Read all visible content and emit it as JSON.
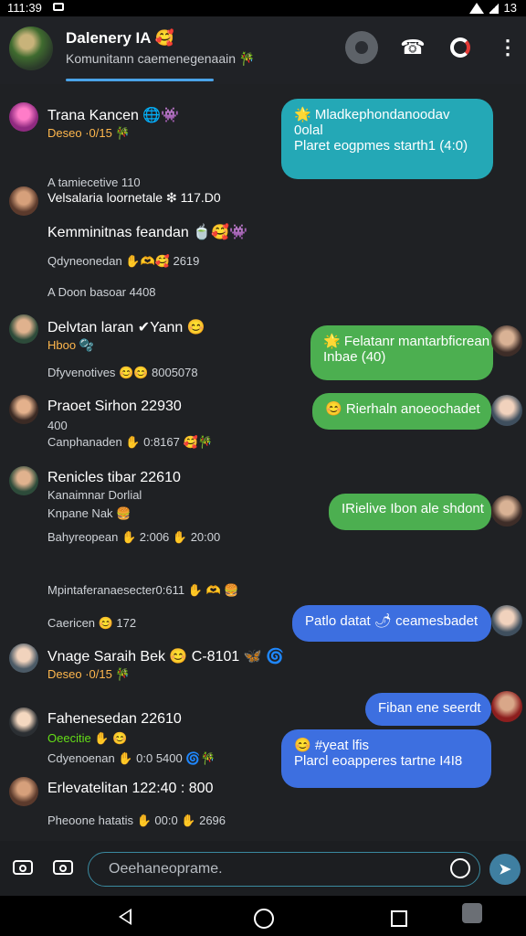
{
  "status_bar": {
    "time": "111:39",
    "right": "13"
  },
  "header": {
    "title": "Dalenery IA 🥰",
    "subtitle": "Komunitann caemenegenaain 🎋"
  },
  "messages_left": [
    {
      "name": "Trana Kancen 🌐👾",
      "meta1": "Deseo ·0/15 🎋",
      "meta2": "A tamiecetive 110"
    },
    {
      "name": "Velsalaria loornetale ❇ 117.D0",
      "meta1": "Kemminitnas feandan 🍵🥰👾",
      "meta2": "Qdyneonedan ✋🫶🥰 2619",
      "meta3": "A Doon basoar 4408"
    },
    {
      "name": "Delvtan laran ✔Yann 😊",
      "meta1": "Hboo 🫧",
      "meta2": "Dfyvenotives 😊😊 8005078"
    },
    {
      "name": "Praoet Sirhon 22930",
      "meta1": "400",
      "meta2": "Canphanaden ✋ 0:8167 🥰🎋"
    },
    {
      "name": "Renicles tibar 22610",
      "meta1": "Kanaimnar Dorlial",
      "meta2": "Knpane Nak 🍔",
      "meta3": "Bahyreopean ✋ 2:006 ✋ 20:00"
    },
    {
      "name": "",
      "meta1": "Mpintaferanaesecter0:611 ✋ 🫶 🍔",
      "meta2": "Caericen 😊 172"
    },
    {
      "name": "Vnage Saraih Bek 😊 C-8101 🦋 🌀",
      "meta1": "Deseo ·0/15 🎋"
    },
    {
      "name": "Fahenesedan 22610",
      "meta1": "Oeecitie ✋ 😊",
      "meta2": "Cdyenoenan ✋ 0:0 5400 🌀🎋"
    },
    {
      "name": "Erlevatelitan 122:40 : 800",
      "meta1": "Pheoone hatatis ✋ 00:0 ✋ 2696"
    }
  ],
  "messages_right": [
    {
      "line1": "🌟 Mladkephondanoodav",
      "line2": "0olal",
      "line3": "Plaret eogpmes starth1 (4:0)"
    },
    {
      "line1": "🌟 Felatanr mantarbficrean",
      "line2": "Inbae (40)"
    },
    {
      "line1": "😊 Rierhaln anoeochadet"
    },
    {
      "line1": "IRielive Ibon ale shdont"
    },
    {
      "line1": "Patlo datat 🌶 ceamesbadet"
    },
    {
      "line1": "Fiban ene seerdt"
    },
    {
      "line1": "😊 #yeat lfis",
      "line2": "Plarcl eoapperes tartne I4I8"
    }
  ],
  "composer": {
    "placeholder": "Oeehaneoprame."
  },
  "icons": [
    "camera-icon",
    "camera-icon",
    "emoji-icon",
    "send-icon",
    "phone-icon",
    "more-icon",
    "chrome-icon"
  ]
}
